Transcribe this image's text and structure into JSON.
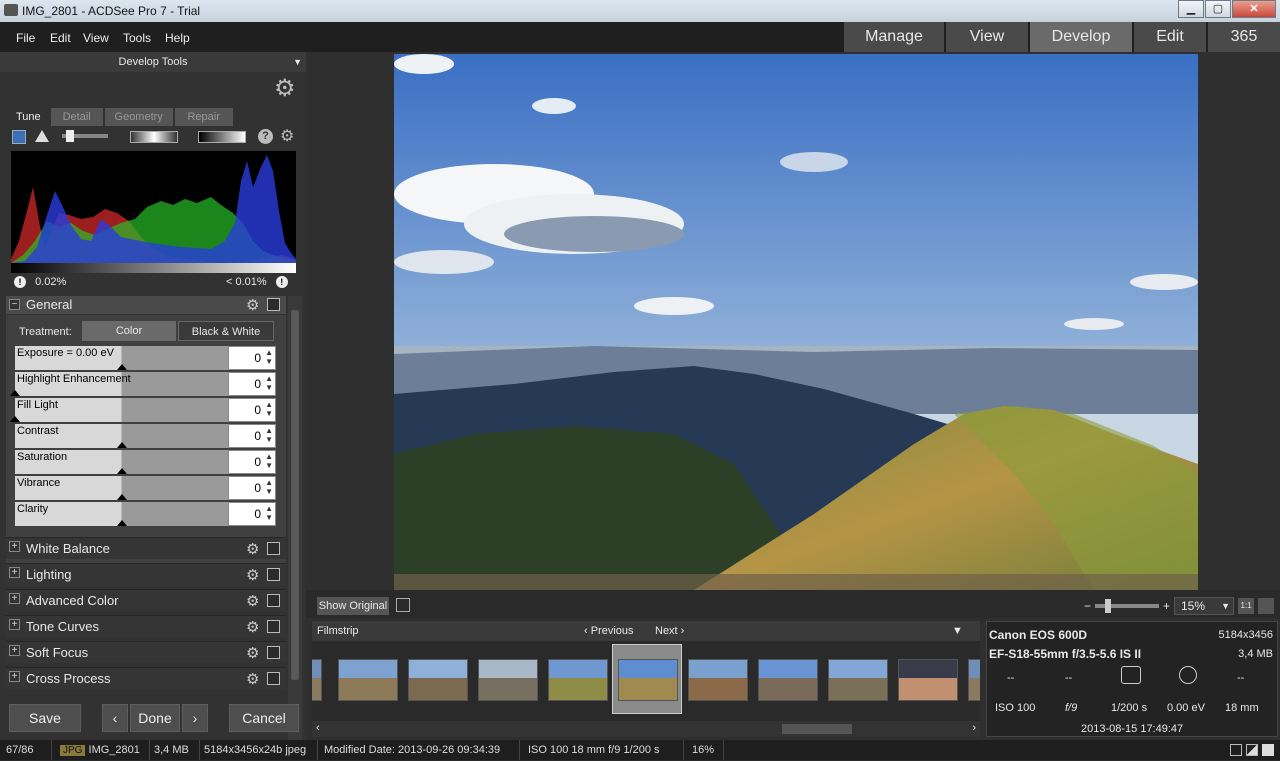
{
  "window": {
    "title": "IMG_2801 - ACDSee Pro 7 - Trial",
    "min": "▁",
    "max": "▢",
    "close": "✕"
  },
  "menu": [
    "File",
    "Edit",
    "View",
    "Tools",
    "Help"
  ],
  "modes": [
    {
      "label": "Manage",
      "active": false
    },
    {
      "label": "View",
      "active": false
    },
    {
      "label": "Develop",
      "active": true
    },
    {
      "label": "Edit",
      "active": false
    },
    {
      "label": "365",
      "active": false
    }
  ],
  "develop_tools": {
    "title": "Develop Tools",
    "dropdown_icon": "▼",
    "gear_icon": "⚙"
  },
  "tabs": [
    "Tune",
    "Detail",
    "Geometry",
    "Repair"
  ],
  "histogram": {
    "clip_low": "0.02%",
    "clip_high": "< 0.01%",
    "warn_icon": "!",
    "help_icon": "?"
  },
  "general": {
    "title": "General",
    "collapse_icon": "−",
    "treatment_label": "Treatment:",
    "treatment_color": "Color",
    "treatment_bw": "Black & White",
    "sliders": [
      {
        "label": "Exposure = 0.00 eV",
        "value": "0",
        "fill": 0.5
      },
      {
        "label": "Highlight Enhancement",
        "value": "0",
        "fill": 0.0
      },
      {
        "label": "Fill Light",
        "value": "0",
        "fill": 0.0
      },
      {
        "label": "Contrast",
        "value": "0",
        "fill": 0.5
      },
      {
        "label": "Saturation",
        "value": "0",
        "fill": 0.5
      },
      {
        "label": "Vibrance",
        "value": "0",
        "fill": 0.5
      },
      {
        "label": "Clarity",
        "value": "0",
        "fill": 0.5
      }
    ],
    "spin_arrows": "▲\n▼"
  },
  "groups": [
    "White Balance",
    "Lighting",
    "Advanced Color",
    "Tone Curves",
    "Soft Focus",
    "Cross Process"
  ],
  "group_expand_icon": "+",
  "buttons": {
    "save": "Save",
    "prev": "‹",
    "done": "Done",
    "next": "›",
    "cancel": "Cancel"
  },
  "viewer": {
    "show_original": "Show Original",
    "zoom": "15%",
    "zoom_minus": "−",
    "zoom_plus": "+",
    "one_to_one": "1:1"
  },
  "filmstrip": {
    "title": "Filmstrip",
    "previous": "‹ Previous",
    "next": "Next ›",
    "collapse": "▼",
    "scroll_left": "‹",
    "scroll_right": "›"
  },
  "info": {
    "camera": "Canon EOS 600D",
    "dimensions": "5184x3456",
    "lens": "EF-S18-55mm f/3.5-5.6 IS II",
    "filesize": "3,4 MB",
    "dash": "--",
    "iso": "ISO 100",
    "aperture": "f/9",
    "shutter": "1/200 s",
    "ev": "0.00 eV",
    "focal": "18 mm",
    "date": "2013-08-15 17:49:47"
  },
  "status": {
    "count": "67/86",
    "type": "JPG",
    "name": "IMG_2801",
    "size": "3,4 MB",
    "dims": "5184x3456x24b jpeg",
    "modified": "Modified Date: 2013-09-26 09:34:39",
    "iso": "ISO 100",
    "focal": "18 mm",
    "aperture": "f/9",
    "shutter": "1/200 s",
    "zoom": "16%"
  },
  "colors": {
    "accent": "#6a6a6a",
    "panel": "#323232",
    "histogram_red": "#e03030",
    "histogram_green": "#30c030",
    "histogram_blue": "#3040e0"
  }
}
